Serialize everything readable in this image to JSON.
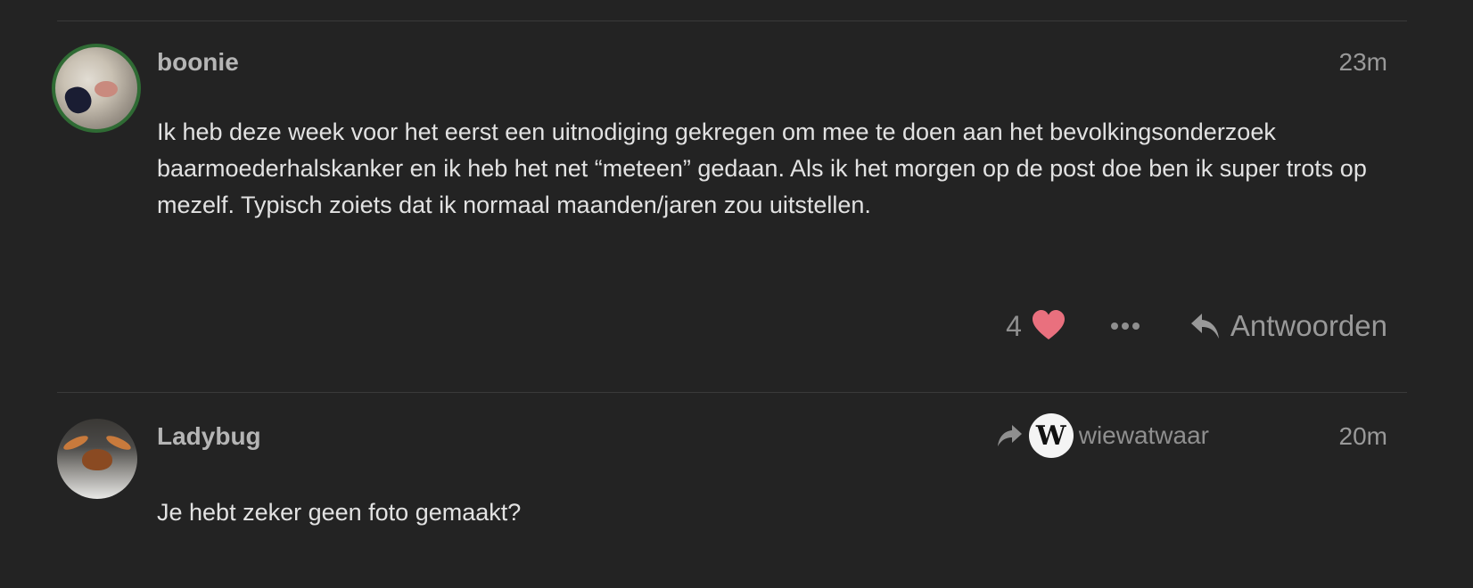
{
  "posts": [
    {
      "username": "boonie",
      "time": "23m",
      "body": [
        "Ik heb deze week voor het eerst een uitnodiging gekregen om mee te doen aan het bevolkingsonderzoek baarmoederhalskanker en ik heb het net “meteen” gedaan. Als ik het morgen op de post doe ben ik super trots op mezelf. Typisch zoiets dat ik normaal maanden/jaren zou uitstellen."
      ],
      "like_count": "4",
      "reply_label": "Antwoorden"
    },
    {
      "username": "Ladybug",
      "time": "20m",
      "reply_to_username": "wiewatwaar",
      "reply_to_avatar_letter": "W",
      "body": [
        "Je hebt zeker geen foto gemaakt?"
      ]
    }
  ],
  "colors": {
    "background": "#232323",
    "heart": "#e9707e",
    "avatar_ring": "#2f6b34"
  }
}
